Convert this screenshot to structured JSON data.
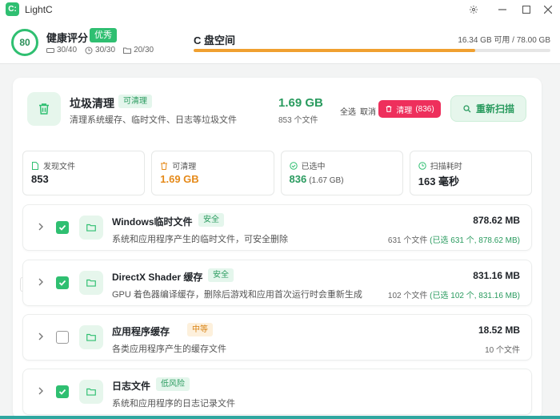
{
  "app": {
    "logo_text": "C:",
    "title": "LightC"
  },
  "health": {
    "score": "80",
    "title": "健康评分",
    "badge": "优秀",
    "stats": [
      {
        "icon": "disk-icon",
        "value": "30/40"
      },
      {
        "icon": "clock-icon",
        "value": "30/30"
      },
      {
        "icon": "folder-icon",
        "value": "20/30"
      }
    ]
  },
  "c_drive": {
    "title": "C 盘空间",
    "usage": "16.34 GB 可用 / 78.00 GB",
    "used_fraction": 0.79
  },
  "junk": {
    "title": "垃圾清理",
    "badge": "可清理",
    "description": "清理系统缓存、临时文件、日志等垃圾文件",
    "size": "1.69 GB",
    "count": "853 个文件",
    "select_all": "全选",
    "cancel": "取消",
    "clean_label": "清理",
    "clean_count": "(836)",
    "rescan_label": "重新扫描"
  },
  "cards": [
    {
      "icon": "file-icon",
      "label": "发现文件",
      "value": "853",
      "sub": ""
    },
    {
      "icon": "trash-icon",
      "label": "可清理",
      "value": "1.69 GB",
      "sub": ""
    },
    {
      "icon": "check-circle-icon",
      "label": "已选中",
      "value": "836",
      "sub": "(1.67 GB)"
    },
    {
      "icon": "clock-icon",
      "label": "扫描耗时",
      "value": "163 毫秒",
      "sub": ""
    }
  ],
  "rows": [
    {
      "title": "Windows临时文件",
      "badge": "安全",
      "badge_type": "safe",
      "desc": "系统和应用程序产生的临时文件，可安全删除",
      "size": "878.62 MB",
      "count": "631 个文件",
      "selected": "(已选 631 个, 878.62 MB)",
      "checked": true
    },
    {
      "title": "DirectX Shader 缓存",
      "badge": "安全",
      "badge_type": "safe",
      "desc": "GPU 着色器编译缓存，删除后游戏和应用首次运行时会重新生成",
      "size": "831.16 MB",
      "count": "102 个文件",
      "selected": "(已选 102 个, 831.16 MB)",
      "checked": true
    },
    {
      "title": "应用程序缓存",
      "badge": "中等",
      "badge_type": "mid",
      "desc": "各类应用程序产生的缓存文件",
      "size": "18.52 MB",
      "count": "10 个文件",
      "selected": "",
      "checked": false
    },
    {
      "title": "日志文件",
      "badge": "低风险",
      "badge_type": "low",
      "desc": "系统和应用程序的日志记录文件",
      "size": "",
      "count": "",
      "selected": "",
      "checked": true
    }
  ],
  "colors": {
    "accent": "#2fbf71",
    "danger": "#ee2f5c",
    "warning": "#f0a030"
  }
}
